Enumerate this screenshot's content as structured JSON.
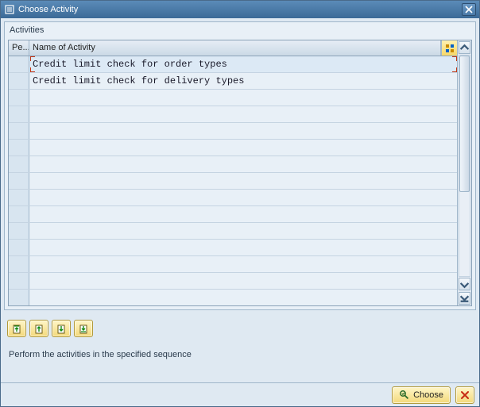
{
  "window": {
    "title": "Choose Activity"
  },
  "group": {
    "title": "Activities"
  },
  "columns": {
    "pe": "Pe...",
    "name": "Name of Activity"
  },
  "rows": [
    {
      "name": "Credit limit check for order types",
      "selected": true
    },
    {
      "name": "Credit limit check for delivery types",
      "selected": false
    },
    {
      "name": "",
      "selected": false
    },
    {
      "name": "",
      "selected": false
    },
    {
      "name": "",
      "selected": false
    },
    {
      "name": "",
      "selected": false
    },
    {
      "name": "",
      "selected": false
    },
    {
      "name": "",
      "selected": false
    },
    {
      "name": "",
      "selected": false
    },
    {
      "name": "",
      "selected": false
    },
    {
      "name": "",
      "selected": false
    },
    {
      "name": "",
      "selected": false
    },
    {
      "name": "",
      "selected": false
    },
    {
      "name": "",
      "selected": false
    },
    {
      "name": "",
      "selected": false
    }
  ],
  "instruction": "Perform the activities in the specified sequence",
  "footer": {
    "choose": "Choose"
  }
}
